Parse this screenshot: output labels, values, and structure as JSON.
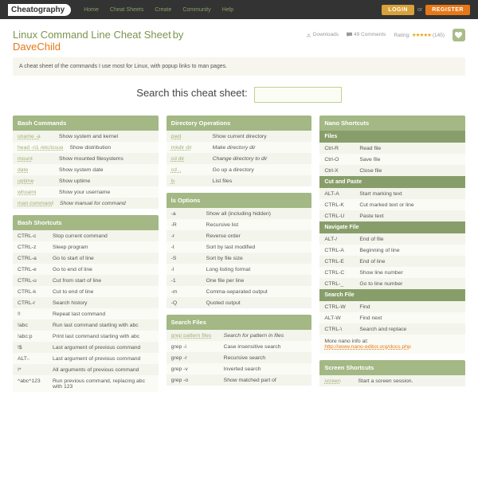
{
  "header": {
    "logo": "Cheatography",
    "nav": [
      "Home",
      "Cheat Sheets",
      "Create",
      "Community",
      "Help"
    ],
    "login": "LOGIN",
    "or": "or",
    "register": "REGISTER"
  },
  "page": {
    "title": "Linux Command Line Cheat Sheet",
    "by": "by",
    "author": "DaveChild",
    "downloads": "Downloads",
    "comments_count": "49 Comments",
    "rating_label": "Rating:",
    "rating_count": "(145)",
    "description": "A cheat sheet of the commands I use most for Linux, with popup links to man pages.",
    "search_label": "Search this cheat sheet:"
  },
  "col1": {
    "bash_commands": {
      "title": "Bash Commands",
      "rows": [
        {
          "cmd": "uname -a",
          "desc": "Show system and kernel"
        },
        {
          "cmd": "head -n1 /etc/issue",
          "desc": "Show distribution"
        },
        {
          "cmd": "mount",
          "desc": "Show mounted filesystems"
        },
        {
          "cmd": "date",
          "desc": "Show system date"
        },
        {
          "cmd": "uptime",
          "desc": "Show uptime"
        },
        {
          "cmd": "whoami",
          "desc": "Show your username"
        },
        {
          "cmd": "man command",
          "desc": "Show manual for command",
          "ital": true
        }
      ]
    },
    "bash_shortcuts": {
      "title": "Bash Shortcuts",
      "rows": [
        {
          "k": "CTRL-c",
          "d": "Stop current command"
        },
        {
          "k": "CTRL-z",
          "d": "Sleep program"
        },
        {
          "k": "CTRL-a",
          "d": "Go to start of line"
        },
        {
          "k": "CTRL-e",
          "d": "Go to end of line"
        },
        {
          "k": "CTRL-u",
          "d": "Cut from start of line"
        },
        {
          "k": "CTRL-k",
          "d": "Cut to end of line"
        },
        {
          "k": "CTRL-r",
          "d": "Search history"
        },
        {
          "k": "!!",
          "d": "Repeat last command"
        },
        {
          "k": "!abc",
          "d": "Run last command starting with abc"
        },
        {
          "k": "!abc:p",
          "d": "Print last command starting with abc"
        },
        {
          "k": "!$",
          "d": "Last argument of previous command"
        },
        {
          "k": "ALT-.",
          "d": "Last argument of previous command"
        },
        {
          "k": "!*",
          "d": "All arguments of previous command"
        },
        {
          "k": "^abc^123",
          "d": "Run previous command, replacing abc with 123"
        }
      ]
    }
  },
  "col2": {
    "dir_ops": {
      "title": "Directory Operations",
      "rows": [
        {
          "cmd": "pwd",
          "desc": "Show current directory"
        },
        {
          "cmd": "mkdir dir",
          "desc": "Make directory dir",
          "ital": true
        },
        {
          "cmd": "cd dir",
          "desc": "Change directory to dir",
          "ital": true
        },
        {
          "cmd": "cd ..",
          "desc": "Go up a directory"
        },
        {
          "cmd": "ls",
          "desc": "List files"
        }
      ]
    },
    "ls_opts": {
      "title": "ls Options",
      "rows": [
        {
          "k": "-a",
          "d": "Show all (including hidden)"
        },
        {
          "k": "-R",
          "d": "Recursive list"
        },
        {
          "k": "-r",
          "d": "Reverse order"
        },
        {
          "k": "-t",
          "d": "Sort by last modified"
        },
        {
          "k": "-S",
          "d": "Sort by file size"
        },
        {
          "k": "-l",
          "d": "Long listing format"
        },
        {
          "k": "-1",
          "d": "One file per line"
        },
        {
          "k": "-m",
          "d": "Comma-separated output"
        },
        {
          "k": "-Q",
          "d": "Quoted output"
        }
      ]
    },
    "search": {
      "title": "Search Files",
      "rows": [
        {
          "cmd": "grep pattern files",
          "desc": "Search for pattern in files",
          "ital": true,
          "link": true
        },
        {
          "cmd": "grep -i",
          "desc": "Case insensitive search"
        },
        {
          "cmd": "grep -r",
          "desc": "Recursive search"
        },
        {
          "cmd": "grep -v",
          "desc": "Inverted search"
        },
        {
          "cmd": "grep -o",
          "desc": "Show matched part of"
        }
      ]
    }
  },
  "col3": {
    "nano": {
      "title": "Nano Shortcuts",
      "files": {
        "title": "Files",
        "rows": [
          {
            "k": "Ctrl-R",
            "d": "Read file"
          },
          {
            "k": "Ctrl-O",
            "d": "Save file"
          },
          {
            "k": "Ctrl-X",
            "d": "Close file"
          }
        ]
      },
      "cut": {
        "title": "Cut and Paste",
        "rows": [
          {
            "k": "ALT-A",
            "d": "Start marking text"
          },
          {
            "k": "CTRL-K",
            "d": "Cut marked text or line"
          },
          {
            "k": "CTRL-U",
            "d": "Paste text"
          }
        ]
      },
      "nav": {
        "title": "Navigate File",
        "rows": [
          {
            "k": "ALT-/",
            "d": "End of file"
          },
          {
            "k": "CTRL-A",
            "d": "Beginning of line"
          },
          {
            "k": "CTRL-E",
            "d": "End of line"
          },
          {
            "k": "CTRL-C",
            "d": "Show line number"
          },
          {
            "k": "CTRL-_",
            "d": "Go to line number"
          }
        ]
      },
      "searchf": {
        "title": "Search File",
        "rows": [
          {
            "k": "CTRL-W",
            "d": "Find"
          },
          {
            "k": "ALT-W",
            "d": "Find next"
          },
          {
            "k": "CTRL-\\",
            "d": "Search and replace"
          }
        ]
      },
      "note": "More nano info at:",
      "note_link": "http://www.nano-editor.org/docs.php"
    },
    "screen": {
      "title": "Screen Shortcuts",
      "rows": [
        {
          "cmd": "screen",
          "desc": "Start a screen session.",
          "link": true
        }
      ]
    }
  }
}
